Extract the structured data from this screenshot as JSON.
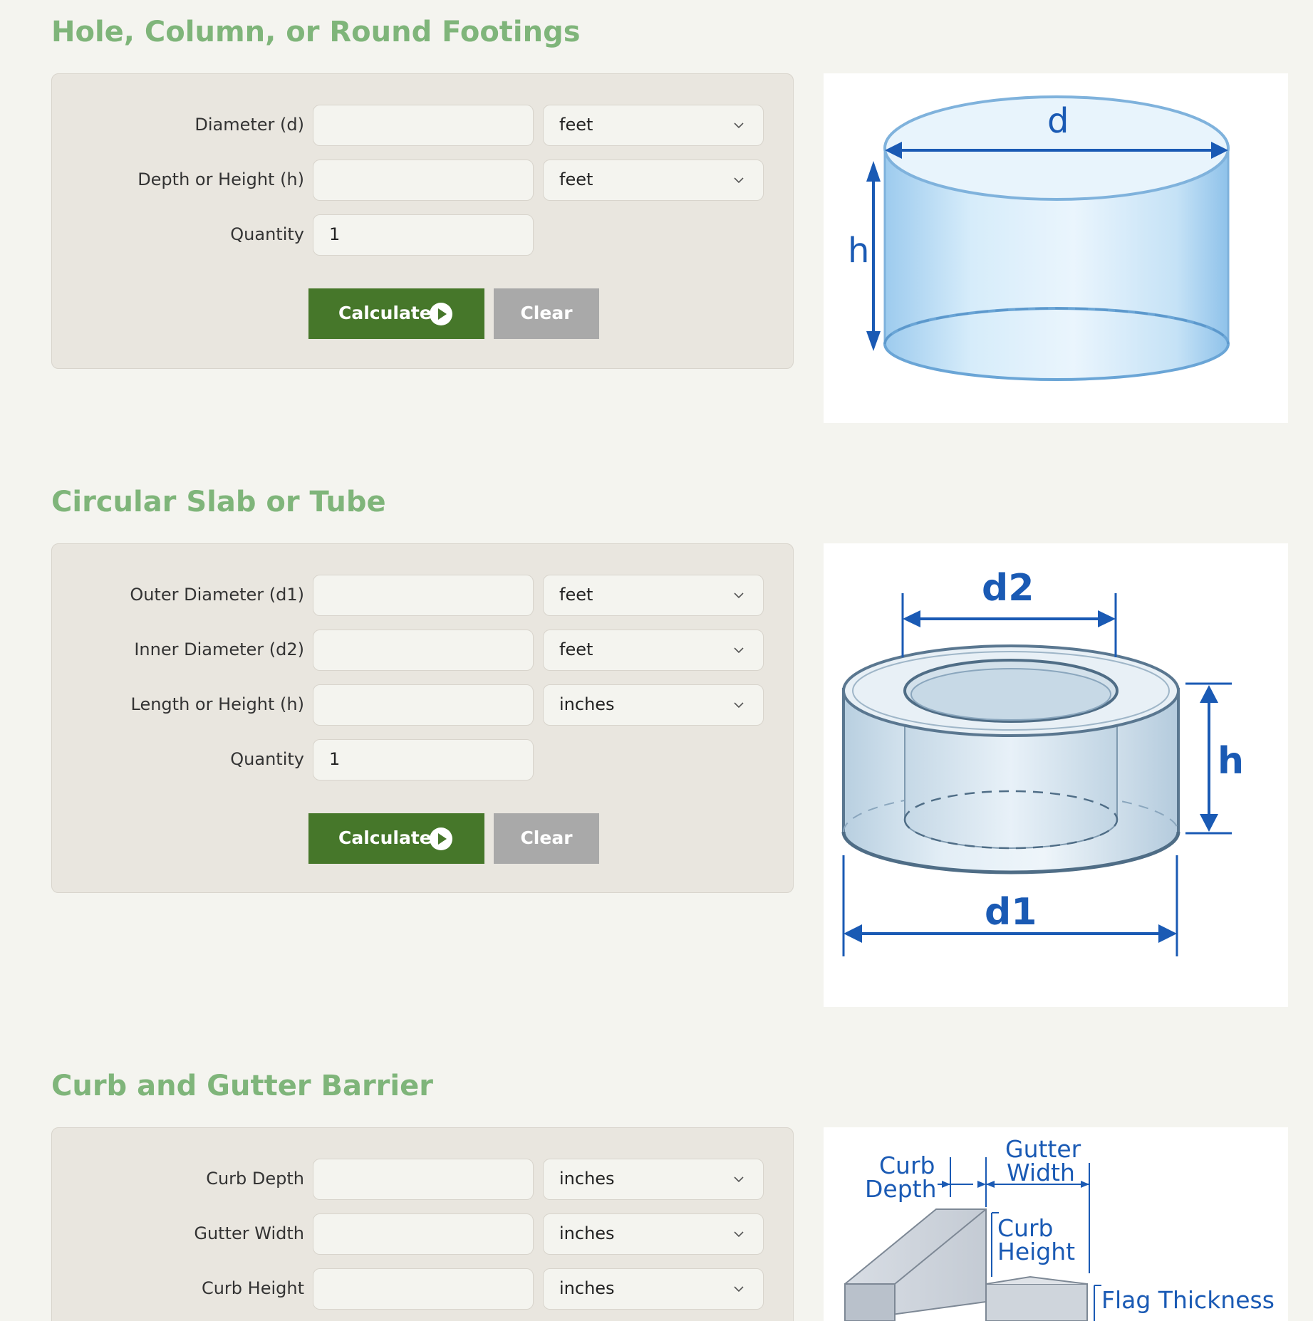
{
  "sections": [
    {
      "title": "Hole, Column, or Round Footings",
      "fields": [
        {
          "label": "Diameter (d)",
          "value": "",
          "unit": "feet"
        },
        {
          "label": "Depth or Height (h)",
          "value": "",
          "unit": "feet"
        },
        {
          "label": "Quantity",
          "value": "1"
        }
      ],
      "calculate_label": "Calculate",
      "clear_label": "Clear",
      "figure_labels": {
        "d": "d",
        "h": "h"
      }
    },
    {
      "title": "Circular Slab or Tube",
      "fields": [
        {
          "label": "Outer Diameter (d1)",
          "value": "",
          "unit": "feet"
        },
        {
          "label": "Inner Diameter (d2)",
          "value": "",
          "unit": "feet"
        },
        {
          "label": "Length or Height (h)",
          "value": "",
          "unit": "inches"
        },
        {
          "label": "Quantity",
          "value": "1"
        }
      ],
      "calculate_label": "Calculate",
      "clear_label": "Clear",
      "figure_labels": {
        "d1": "d1",
        "d2": "d2",
        "h": "h"
      }
    },
    {
      "title": "Curb and Gutter Barrier",
      "fields": [
        {
          "label": "Curb Depth",
          "value": "",
          "unit": "inches"
        },
        {
          "label": "Gutter Width",
          "value": "",
          "unit": "inches"
        },
        {
          "label": "Curb Height",
          "value": "",
          "unit": "inches"
        }
      ],
      "figure_labels": {
        "curb_depth_1": "Curb",
        "curb_depth_2": "Depth",
        "gutter_width_1": "Gutter",
        "gutter_width_2": "Width",
        "curb_height_1": "Curb",
        "curb_height_2": "Height",
        "flag_thickness": "Flag Thickness"
      }
    }
  ],
  "colors": {
    "title_green": "#7fb57a",
    "calculate_bg": "#46772a",
    "clear_bg": "#a9a9a9",
    "panel_bg": "#e9e6df",
    "dimension_blue": "#1a5ab4"
  }
}
